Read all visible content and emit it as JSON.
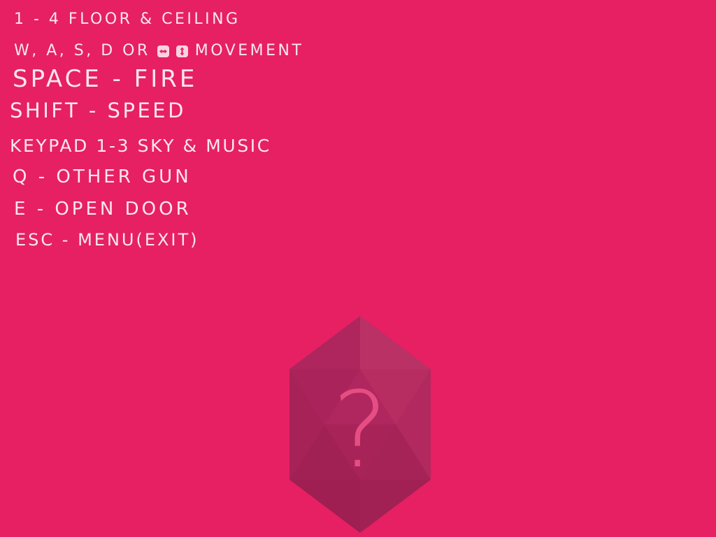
{
  "controls": {
    "floor_ceiling": "1 - 4 FLOOR & CEILING",
    "movement_prefix": "W, A, S, D OR",
    "movement_icons": [
      "left-right-arrow-icon",
      "up-down-arrow-icon"
    ],
    "movement_suffix": "MOVEMENT",
    "fire": "SPACE - FIRE",
    "speed": "SHIFT - SPEED",
    "sky_music": "KEYPAD 1-3 SKY & MUSIC",
    "other_gun": "Q - OTHER GUN",
    "open_door": "E - OPEN DOOR",
    "menu": "ESC - MENU(EXIT)"
  },
  "mystery_badge": {
    "symbol": "?",
    "icon": "hexagon-question-icon"
  },
  "colors": {
    "background": "#e62063",
    "text": "#fbe6ee",
    "badge": "#b3245c"
  }
}
